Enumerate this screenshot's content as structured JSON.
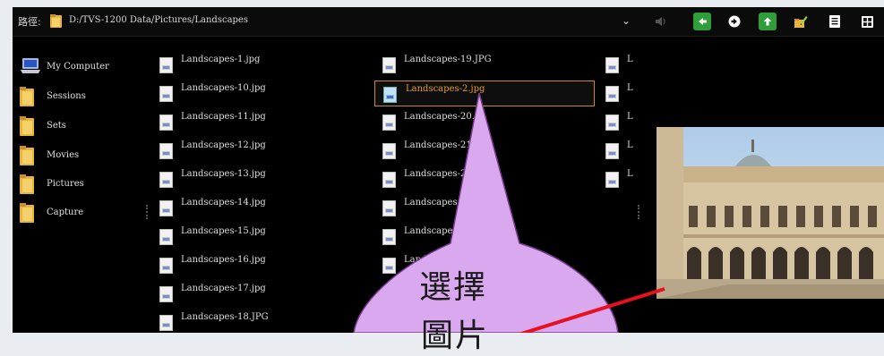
{
  "topbar": {
    "path_label": "路徑:",
    "path_value": "D:/TVS-1200 Data/Pictures/Landscapes",
    "dropdown_glyph": "⌄",
    "icons": [
      "speaker-icon",
      "back-icon",
      "forward-icon",
      "up-icon",
      "edit-icon",
      "list-view-icon",
      "grid-view-icon"
    ]
  },
  "sidebar": {
    "items": [
      {
        "label": "My Computer",
        "icon": "computer-icon"
      },
      {
        "label": "Sessions",
        "icon": "folder-icon"
      },
      {
        "label": "Sets",
        "icon": "folder-icon"
      },
      {
        "label": "Movies",
        "icon": "folder-icon"
      },
      {
        "label": "Pictures",
        "icon": "folder-icon"
      },
      {
        "label": "Capture",
        "icon": "folder-icon"
      }
    ]
  },
  "files": {
    "col1": [
      "Landscapes-1.jpg",
      "Landscapes-10.jpg",
      "Landscapes-11.jpg",
      "Landscapes-12.jpg",
      "Landscapes-13.jpg",
      "Landscapes-14.jpg",
      "Landscapes-15.jpg",
      "Landscapes-16.jpg",
      "Landscapes-17.jpg",
      "Landscapes-18.JPG"
    ],
    "col2": [
      "Landscapes-19.JPG",
      "Landscapes-2.jpg",
      "Landscapes-20.jp",
      "Landscapes-21.",
      "Landscapes-2",
      "Landscapes",
      "Landscape",
      "Landscapes-2",
      "Landscapes-2"
    ],
    "col3": [
      "L",
      "L",
      "L",
      "L",
      "L"
    ],
    "selected": "Landscapes-2.jpg"
  },
  "callout": {
    "line1": "選擇",
    "line2": "圖片",
    "fill": "#d9a8ee",
    "stroke": "#7a3b8f"
  },
  "colors": {
    "accent_selected": "#e39a2f",
    "nav_green": "#2f9e3a",
    "arrow_red": "#e8101f"
  }
}
